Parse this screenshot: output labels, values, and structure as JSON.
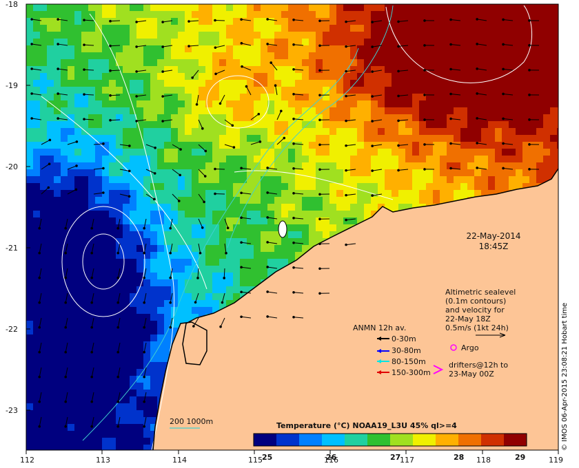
{
  "lat_labels": [
    "-18",
    "-19",
    "-20",
    "-21",
    "-22",
    "-23"
  ],
  "lon_labels": [
    "112",
    "113",
    "114",
    "115",
    "116",
    "117",
    "118",
    "119"
  ],
  "timestamp": {
    "date": "22-May-2014",
    "time": "18:45Z"
  },
  "altimetry": {
    "lines": [
      "Altimetric sealevel",
      "(0.1m contours)",
      "and velocity for",
      "22-May 18Z",
      "0.5m/s (1kt 24h)"
    ]
  },
  "moorings": {
    "title": "ANMN 12h av.",
    "items": [
      {
        "label": "0-30m",
        "color": "#000000"
      },
      {
        "label": "30-80m",
        "color": "#0000ff"
      },
      {
        "label": "80-150m",
        "color": "#00e5e5"
      },
      {
        "label": "150-300m",
        "color": "#e00000"
      }
    ]
  },
  "argo": {
    "label": "Argo",
    "color": "#ff00ff"
  },
  "drifters": {
    "lines": [
      "drifters@12h to",
      "23-May 00Z"
    ],
    "color": "#ff00ff"
  },
  "bathymetry_label": "200  1000m",
  "colorbar": {
    "title": "Temperature (°C) NOAA19_L3U 45% ql>=4",
    "ticks": [
      "25",
      "26",
      "27",
      "28",
      "29"
    ],
    "colors": [
      "#00007f",
      "#0033cc",
      "#0080ff",
      "#00c0ff",
      "#20d0a0",
      "#30c030",
      "#a0e020",
      "#f0f000",
      "#ffb000",
      "#f07000",
      "#d03000",
      "#900000"
    ]
  },
  "credit": "© IMOS 06-Apr-2015 23:08:21 Hobart time",
  "colors": {
    "land": "#fdc596",
    "background": "#ffffff"
  }
}
